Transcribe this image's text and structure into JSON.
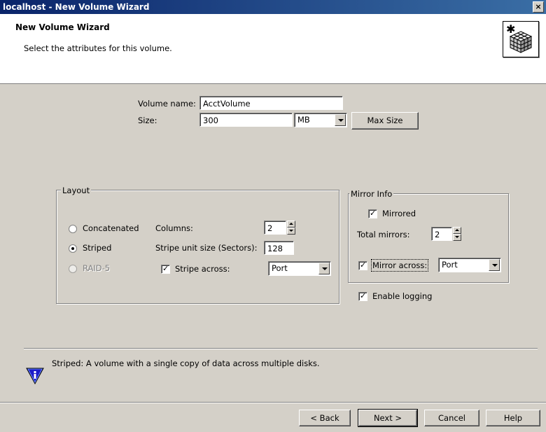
{
  "window": {
    "title": "localhost - New Volume Wizard",
    "close": "×"
  },
  "header": {
    "title": "New Volume Wizard",
    "subtitle": "Select the attributes for this volume."
  },
  "form": {
    "volume_name_label": "Volume name:",
    "volume_name_value": "AcctVolume",
    "size_label": "Size:",
    "size_value": "300",
    "size_unit": "MB",
    "max_size_button": "Max Size"
  },
  "layout": {
    "group_label": "Layout",
    "options": [
      {
        "label": "Concatenated",
        "selected": false,
        "enabled": true
      },
      {
        "label": "Striped",
        "selected": true,
        "enabled": true
      },
      {
        "label": "RAID-5",
        "selected": false,
        "enabled": false
      }
    ],
    "columns_label": "Columns:",
    "columns_value": "2",
    "stripe_unit_label": "Stripe unit size (Sectors):",
    "stripe_unit_value": "128",
    "stripe_across_label": "Stripe across:",
    "stripe_across_checked": true,
    "stripe_across_value": "Port"
  },
  "mirror": {
    "group_label": "Mirror Info",
    "mirrored_label": "Mirrored",
    "mirrored_checked": true,
    "total_mirrors_label": "Total mirrors:",
    "total_mirrors_value": "2",
    "mirror_across_label": "Mirror across:",
    "mirror_across_checked": true,
    "mirror_across_value": "Port"
  },
  "logging": {
    "label": "Enable logging",
    "checked": true
  },
  "info": {
    "text": "Striped: A volume with a single copy of data across multiple disks."
  },
  "footer": {
    "back": "< Back",
    "next": "Next >",
    "cancel": "Cancel",
    "help": "Help"
  },
  "colors": {
    "titlebar": "#0a246a",
    "face": "#d4d0c8",
    "info_icon": "#1c1cc8"
  }
}
